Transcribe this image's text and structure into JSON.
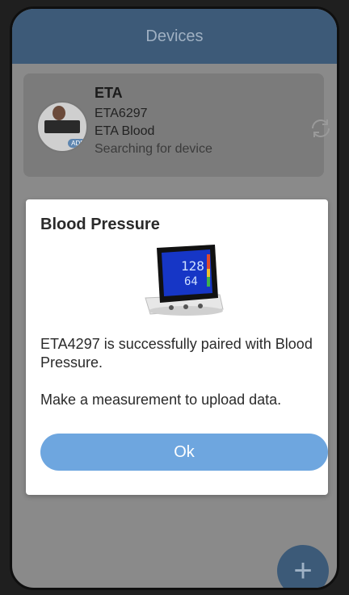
{
  "appbar": {
    "title": "Devices"
  },
  "device": {
    "name": "ETA",
    "model": "ETA6297",
    "type": "ETA Blood",
    "status": "Searching for device",
    "thumb_badge": "ADD",
    "icon": "sync-icon"
  },
  "dialog": {
    "title": "Blood Pressure",
    "message_paired": "ETA4297 is successfully paired with Blood Pressure.",
    "message_action": "Make a measurement to upload data.",
    "ok_label": "Ok",
    "device_screen": {
      "systolic": "128",
      "diastolic": "64"
    }
  },
  "fab": {
    "label": "+",
    "icon": "add-icon"
  },
  "colors": {
    "appbar": "#3d5a78",
    "button": "#6ea6df",
    "fab": "#3c5a78",
    "overlay": "#8a8a8a"
  }
}
